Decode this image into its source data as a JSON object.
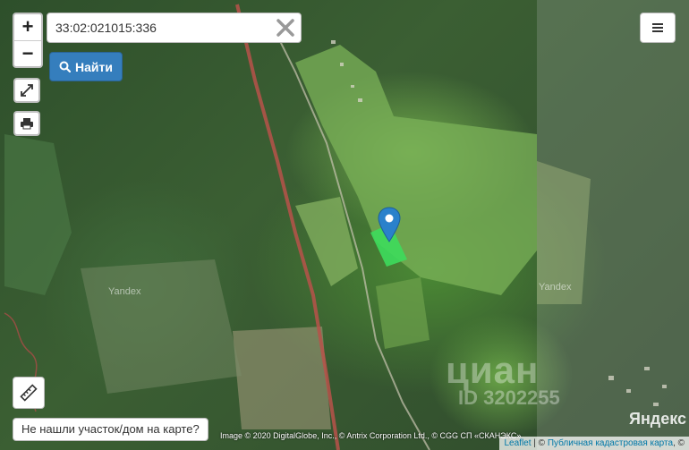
{
  "search": {
    "value": "33:02:021015:336",
    "find_label": "Найти"
  },
  "zoom": {
    "in_label": "+",
    "out_label": "−"
  },
  "map": {
    "watermark_yandex": "Yandex",
    "watermark_cian": "циан",
    "watermark_cian_id": "ID 3202255",
    "logo": "Яндекс",
    "imagery_credit": "Image © 2020 DigitalGlobe, Inc., © Antrix Corporation Ltd., © CGG СП «СКАНЭКС»",
    "attribution": {
      "leaflet": "Leaflet",
      "separator": " | © ",
      "cadastral": "Публичная кадастровая карта",
      "suffix": ", ©"
    }
  },
  "not_found_label": "Не нашли участок/дом на карте?",
  "icons": {
    "fullscreen": "expand-icon",
    "print": "printer-icon",
    "menu": "hamburger-icon",
    "ruler": "ruler-icon",
    "clear": "close-icon",
    "search": "search-icon",
    "marker": "map-marker-icon"
  },
  "colors": {
    "parcel": "#3ddc5c",
    "marker": "#2a81cb",
    "find_button": "#357ebd"
  }
}
